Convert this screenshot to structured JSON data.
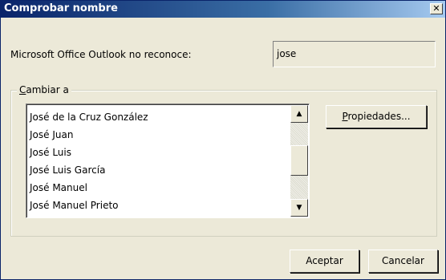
{
  "window": {
    "title": "Comprobar nombre",
    "close_glyph": "✕"
  },
  "prompt": {
    "label": "Microsoft Office Outlook no reconoce:",
    "name_value": "jose"
  },
  "change_group": {
    "legend_underlined": "C",
    "legend_rest": "ambiar a",
    "items": [
      "José de la Cruz González",
      "José Juan",
      "José Luis",
      "José Luis García",
      "José Manuel",
      "José Manuel Prieto"
    ]
  },
  "scrollbar": {
    "up_glyph": "▲",
    "down_glyph": "▼"
  },
  "buttons": {
    "properties_underlined": "P",
    "properties_rest": "ropiedades...",
    "ok": "Aceptar",
    "cancel": "Cancelar"
  }
}
